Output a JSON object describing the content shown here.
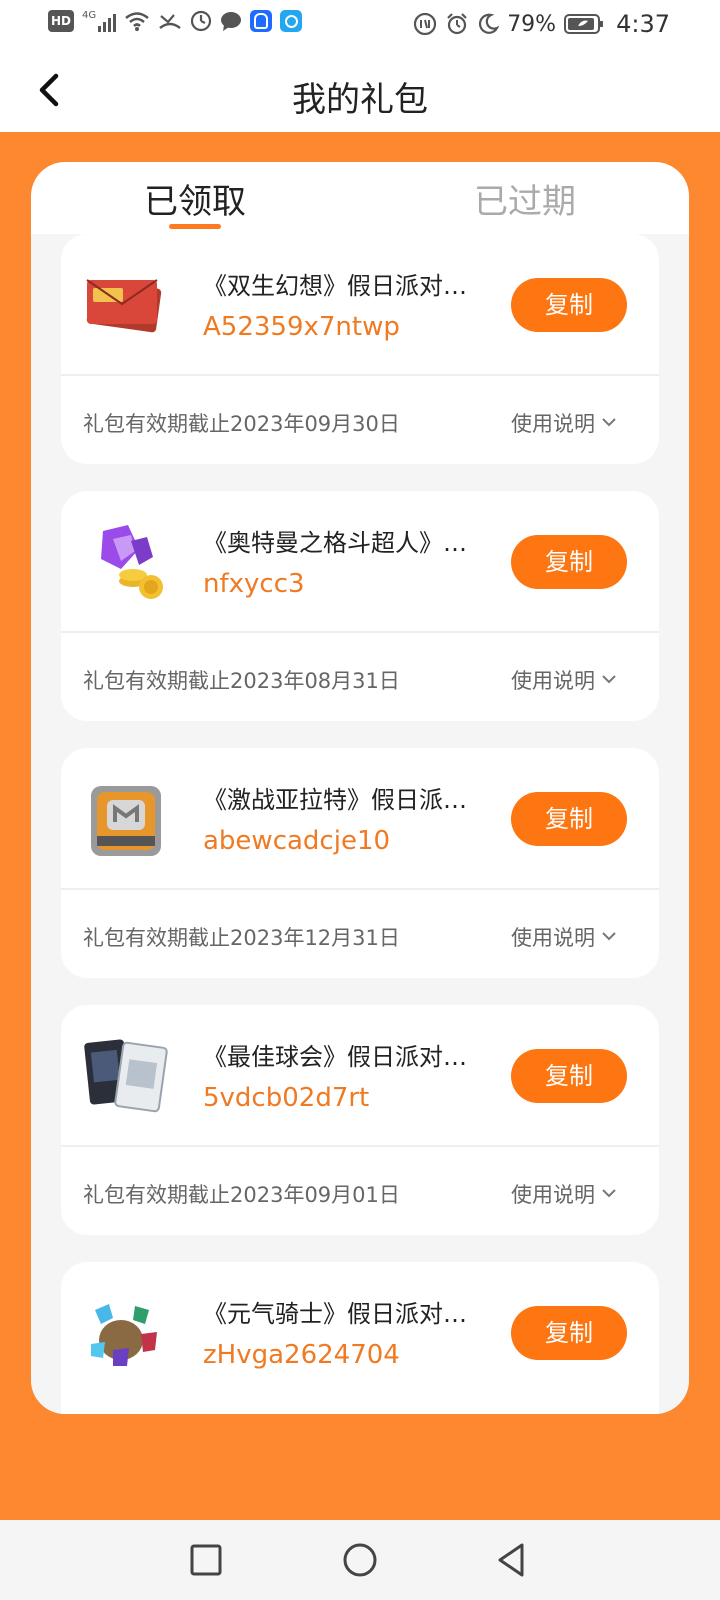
{
  "status_bar": {
    "left_icons": [
      "hd-icon",
      "signal-4g-icon",
      "wifi-icon",
      "missed-call-icon",
      "timer-icon",
      "chat-icon",
      "app-icon-blue",
      "search-app-icon"
    ],
    "hd_text": "HD",
    "net_text": "4G",
    "battery": "79%",
    "time": "4:37",
    "right_icons": [
      "data-saver-icon",
      "alarm-icon",
      "moon-icon",
      "battery-icon"
    ]
  },
  "header": {
    "title": "我的礼包"
  },
  "tabs": [
    {
      "label": "已领取",
      "active": true
    },
    {
      "label": "已过期",
      "active": false
    }
  ],
  "gifts": [
    {
      "name": "《双生幻想》假日派对…",
      "code": "A52359x7ntwp",
      "expiry": "礼包有效期截止2023年09月30日",
      "copy_label": "复制",
      "usage_label": "使用说明"
    },
    {
      "name": "《奥特曼之格斗超人》…",
      "code": "nfxycc3",
      "expiry": "礼包有效期截止2023年08月31日",
      "copy_label": "复制",
      "usage_label": "使用说明"
    },
    {
      "name": "《激战亚拉特》假日派…",
      "code": "abewcadcje10",
      "expiry": "礼包有效期截止2023年12月31日",
      "copy_label": "复制",
      "usage_label": "使用说明"
    },
    {
      "name": "《最佳球会》假日派对…",
      "code": "5vdcb02d7rt",
      "expiry": "礼包有效期截止2023年09月01日",
      "copy_label": "复制",
      "usage_label": "使用说明"
    },
    {
      "name": "《元气骑士》假日派对…",
      "code": "zHvga2624704",
      "expiry": "",
      "copy_label": "复制",
      "usage_label": ""
    }
  ],
  "colors": {
    "accent": "#FD7612",
    "background": "#FD8830",
    "code_text": "#F07A22"
  },
  "navbar": {
    "icons": [
      "recents-square-icon",
      "home-circle-icon",
      "back-triangle-icon"
    ]
  }
}
